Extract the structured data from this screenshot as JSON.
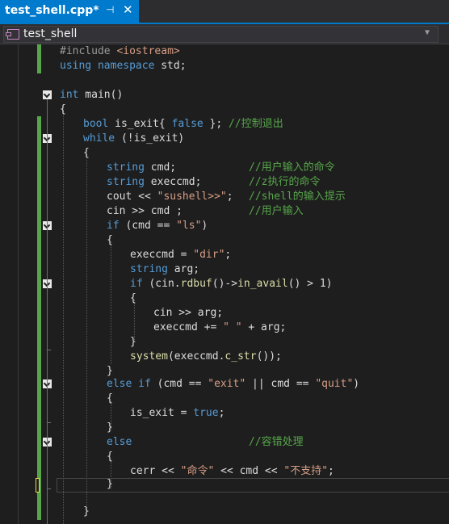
{
  "tab": {
    "title": "test_shell.cpp*",
    "pin": "⊣",
    "close": "✕"
  },
  "nav": {
    "scope": "test_shell"
  },
  "code": {
    "l1a": "#include ",
    "l1b": "<iostream>",
    "l2a": "using namespace",
    "l2b": " std;",
    "l4a": "int",
    "l4b": " main()",
    "l5": "{",
    "l6a": "bool",
    "l6b": " is_exit{ ",
    "l6c": "false",
    "l6d": " }; ",
    "l6e": "//控制退出",
    "l7a": "while",
    "l7b": " (!is_exit)",
    "l8": "{",
    "l9a": "string",
    "l9b": " cmd;",
    "l9c": "//用户输入的命令",
    "l10a": "string",
    "l10b": " execcmd;",
    "l10c": "//z执行的命令",
    "l11a": "cout << ",
    "l11b": "\"sushell>>\"",
    "l11c": ";",
    "l11d": "//shell的输入提示",
    "l12a": "cin >> cmd ;",
    "l12b": "//用户输入",
    "l13a": "if",
    "l13b": " (cmd == ",
    "l13c": "\"ls\"",
    "l13d": ")",
    "l14": "{",
    "l15a": "execcmd = ",
    "l15b": "\"dir\"",
    "l15c": ";",
    "l16a": "string",
    "l16b": " arg;",
    "l17a": "if",
    "l17b": " (cin.",
    "l17c": "rdbuf",
    "l17d": "()->",
    "l17e": "in_avail",
    "l17f": "() > 1)",
    "l18": "{",
    "l19": "cin >> arg;",
    "l20a": "execcmd += ",
    "l20b": "\" \"",
    "l20c": " + arg;",
    "l21": "}",
    "l22a": "system",
    "l22b": "(execcmd.",
    "l22c": "c_str",
    "l22d": "());",
    "l23": "}",
    "l24a": "else if",
    "l24b": " (cmd == ",
    "l24c": "\"exit\"",
    "l24d": " || cmd == ",
    "l24e": "\"quit\"",
    "l24f": ")",
    "l25": "{",
    "l26a": "is_exit = ",
    "l26b": "true",
    "l26c": ";",
    "l27": "}",
    "l28a": "else",
    "l28b": "//容错处理",
    "l29": "{",
    "l30a": "cerr << ",
    "l30b": "\"命令\"",
    "l30c": " << cmd << ",
    "l30d": "\"不支持\"",
    "l30e": ";",
    "l31": "}",
    "l33": "}"
  }
}
